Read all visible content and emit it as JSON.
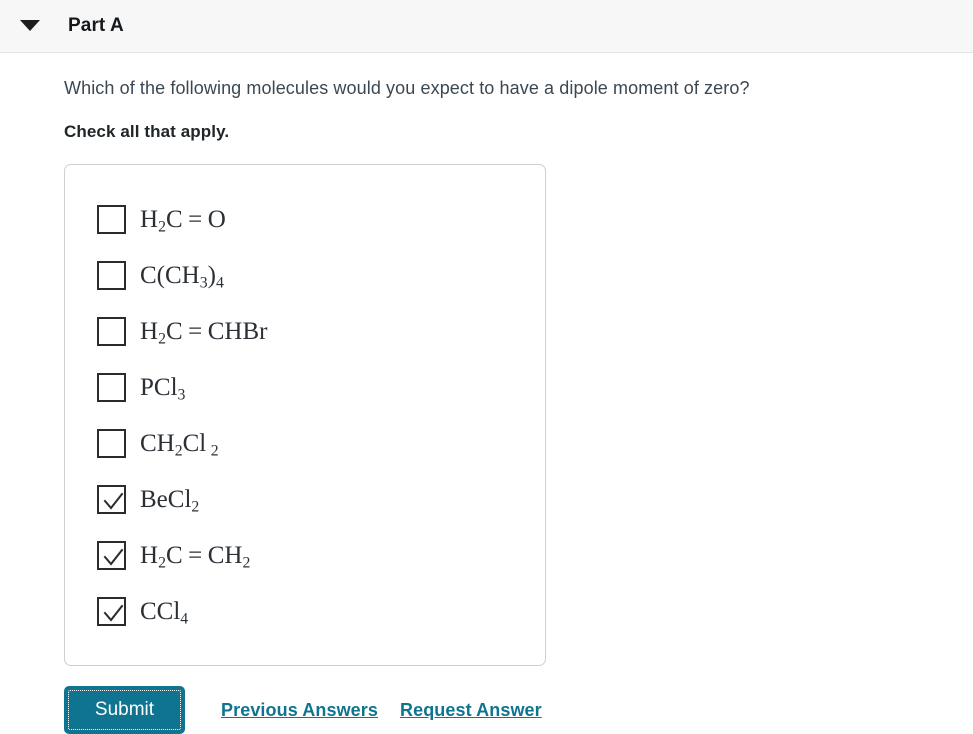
{
  "header": {
    "caret_icon": "chevron-down-icon",
    "title": "Part A"
  },
  "question": {
    "text": "Which of the following molecules would you expect to have a dipole moment of zero?",
    "instruction": "Check all that apply."
  },
  "choices": [
    {
      "id": "choice-1",
      "formula_plain": "H2C=O",
      "checked": false,
      "parts": [
        {
          "t": "H"
        },
        {
          "t": "2",
          "sub": true
        },
        {
          "t": "C"
        },
        {
          "t": "=",
          "eq": true
        },
        {
          "t": "O"
        }
      ]
    },
    {
      "id": "choice-2",
      "formula_plain": "C(CH3)4",
      "checked": false,
      "parts": [
        {
          "t": "C(CH"
        },
        {
          "t": "3",
          "sub": true
        },
        {
          "t": ")"
        },
        {
          "t": "4",
          "sub": true
        }
      ]
    },
    {
      "id": "choice-3",
      "formula_plain": "H2C=CHBr",
      "checked": false,
      "parts": [
        {
          "t": "H"
        },
        {
          "t": "2",
          "sub": true
        },
        {
          "t": "C"
        },
        {
          "t": "=",
          "eq": true
        },
        {
          "t": "CHBr"
        }
      ]
    },
    {
      "id": "choice-4",
      "formula_plain": "PCl3",
      "checked": false,
      "parts": [
        {
          "t": "PCl"
        },
        {
          "t": "3",
          "sub": true
        }
      ]
    },
    {
      "id": "choice-5",
      "formula_plain": "CH2Cl2",
      "checked": false,
      "parts": [
        {
          "t": "CH"
        },
        {
          "t": "2",
          "sub": true
        },
        {
          "t": "Cl",
          "space": true
        },
        {
          "t": "2",
          "sub": true
        }
      ]
    },
    {
      "id": "choice-6",
      "formula_plain": "BeCl2",
      "checked": true,
      "parts": [
        {
          "t": "BeCl"
        },
        {
          "t": "2",
          "sub": true
        }
      ]
    },
    {
      "id": "choice-7",
      "formula_plain": "H2C=CH2",
      "checked": true,
      "parts": [
        {
          "t": "H"
        },
        {
          "t": "2",
          "sub": true
        },
        {
          "t": "C"
        },
        {
          "t": "=",
          "eq": true
        },
        {
          "t": "CH"
        },
        {
          "t": "2",
          "sub": true
        }
      ]
    },
    {
      "id": "choice-8",
      "formula_plain": "CCl4",
      "checked": true,
      "parts": [
        {
          "t": "CCl"
        },
        {
          "t": "4",
          "sub": true
        }
      ]
    }
  ],
  "actions": {
    "submit_label": "Submit",
    "previous_answers_label": "Previous Answers",
    "request_answer_label": "Request Answer"
  },
  "colors": {
    "accent": "#0e7490",
    "header_bg": "#f7f7f7",
    "question_text": "#3b4852",
    "box_border": "#cfcfcf"
  }
}
